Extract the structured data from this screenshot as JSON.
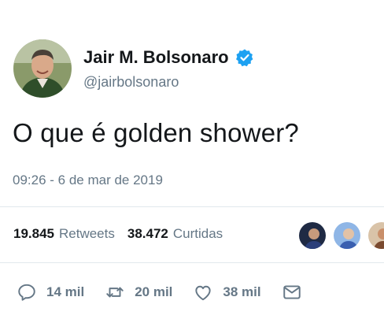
{
  "user": {
    "display_name": "Jair M. Bolsonaro",
    "handle": "@jairbolsonaro",
    "verified": true
  },
  "tweet": {
    "text": "O que é golden shower?",
    "timestamp": "09:26 - 6 de mar de 2019"
  },
  "stats": {
    "retweets_count": "19.845",
    "retweets_label": "Retweets",
    "likes_count": "38.472",
    "likes_label": "Curtidas"
  },
  "actions": {
    "replies": "14 mil",
    "retweets": "20 mil",
    "likes": "38 mil"
  },
  "colors": {
    "accent": "#1da1f2",
    "text": "#14171a",
    "muted": "#657786",
    "divider": "#e1e8ed"
  },
  "icons": [
    "verified-badge-icon",
    "reply-icon",
    "retweet-icon",
    "like-icon",
    "direct-message-icon"
  ]
}
